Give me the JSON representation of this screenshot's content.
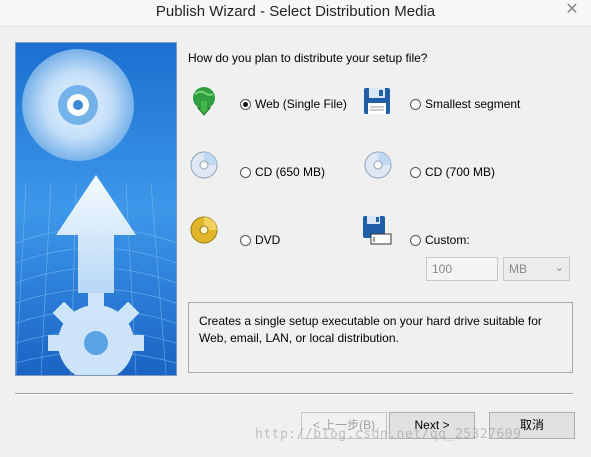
{
  "window": {
    "title": "Publish Wizard - Select Distribution Media",
    "close_glyph": "✕"
  },
  "question": "How do you plan to distribute your setup file?",
  "options": {
    "web": {
      "label": "Web (Single File)",
      "selected": true,
      "icon": "globe-download-icon"
    },
    "smallest": {
      "label": "Smallest segment",
      "selected": false,
      "icon": "floppy-disk-icon"
    },
    "cd650": {
      "label": "CD (650 MB)",
      "selected": false,
      "icon": "cd-disc-icon"
    },
    "cd700": {
      "label": "CD (700 MB)",
      "selected": false,
      "icon": "cd-disc-icon"
    },
    "dvd": {
      "label": "DVD",
      "selected": false,
      "icon": "dvd-disc-icon"
    },
    "custom": {
      "label": "Custom:",
      "selected": false,
      "icon": "floppy-custom-icon"
    }
  },
  "custom_size": {
    "value": "100",
    "unit": "MB"
  },
  "description": "Creates a single setup executable on your hard drive suitable for Web, email, LAN, or local distribution.",
  "buttons": {
    "back": "< 上一步(B)",
    "next": "Next >",
    "cancel": "取消"
  },
  "watermark": "http://blog.csdn.net/qq_25327609",
  "colors": {
    "accent_blue": "#1f78d1",
    "disc_gold": "#d4a017",
    "globe_green": "#2e9e3e"
  }
}
